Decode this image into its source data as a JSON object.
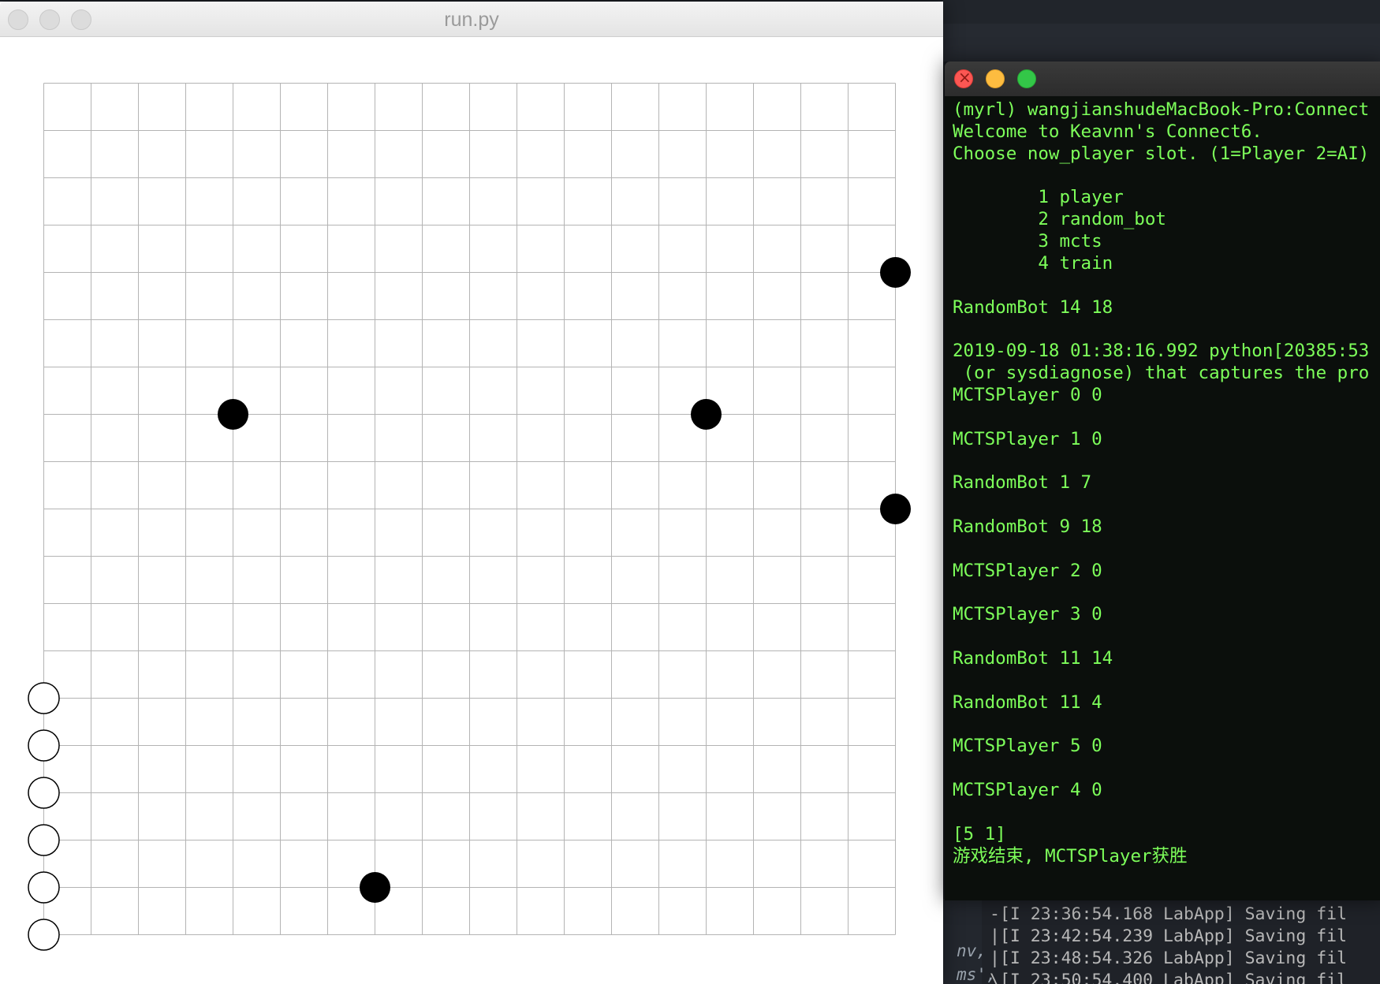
{
  "board_window": {
    "title": "run.py",
    "board_size": 19,
    "stones": [
      {
        "col": 18,
        "row": 4,
        "color": "black"
      },
      {
        "col": 4,
        "row": 7,
        "color": "black"
      },
      {
        "col": 14,
        "row": 7,
        "color": "black"
      },
      {
        "col": 18,
        "row": 9,
        "color": "black"
      },
      {
        "col": 7,
        "row": 17,
        "color": "black"
      },
      {
        "col": 0,
        "row": 13,
        "color": "white"
      },
      {
        "col": 0,
        "row": 14,
        "color": "white"
      },
      {
        "col": 0,
        "row": 15,
        "color": "white"
      },
      {
        "col": 0,
        "row": 16,
        "color": "white"
      },
      {
        "col": 0,
        "row": 17,
        "color": "white"
      },
      {
        "col": 0,
        "row": 18,
        "color": "white"
      }
    ],
    "colors": {
      "grid": "#b4b4b4",
      "black_stone": "#000000",
      "white_stone": "#ffffff"
    }
  },
  "terminal": {
    "text_color": "#7dff5a",
    "background": "#0b0f0c",
    "lines": [
      "(myrl) wangjianshudeMacBook-Pro:Connect",
      "Welcome to Keavnn's Connect6.",
      "Choose now_player slot. (1=Player 2=AI)",
      "",
      "        1 player",
      "        2 random_bot",
      "        3 mcts",
      "        4 train",
      "",
      "RandomBot 14 18",
      "",
      "2019-09-18 01:38:16.992 python[20385:53",
      " (or sysdiagnose) that captures the pro",
      "MCTSPlayer 0 0",
      "",
      "MCTSPlayer 1 0",
      "",
      "RandomBot 1 7",
      "",
      "RandomBot 9 18",
      "",
      "MCTSPlayer 2 0",
      "",
      "MCTSPlayer 3 0",
      "",
      "RandomBot 11 14",
      "",
      "RandomBot 11 4",
      "",
      "MCTSPlayer 5 0",
      "",
      "MCTSPlayer 4 0",
      "",
      "[5 1]",
      "游戏结束, MCTSPlayer获胜"
    ]
  },
  "log_window": {
    "gutter": [
      "nv,",
      "ms',"
    ],
    "lines": [
      "-[I 23:36:54.168 LabApp] Saving fil",
      "|[I 23:42:54.239 LabApp] Saving fil",
      "|[I 23:48:54.326 LabApp] Saving fil",
      "\\[I 23:50:54.400 LabApp] Saving fil"
    ]
  }
}
